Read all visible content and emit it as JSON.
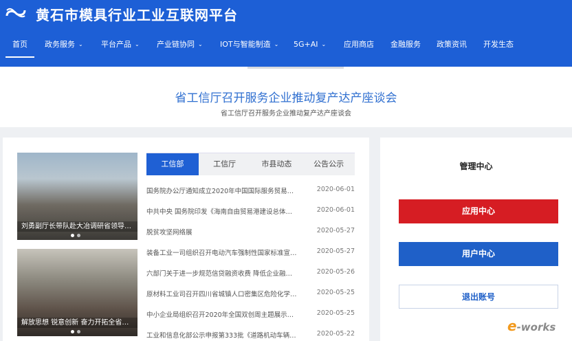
{
  "header": {
    "site_title": "黄石市模具行业工业互联网平台",
    "logo_icon": "infinity-logo-icon",
    "bg_color": "#1d5fd6"
  },
  "nav": {
    "items": [
      {
        "label": "首页",
        "chevron": false,
        "active": true
      },
      {
        "label": "政务服务",
        "chevron": true
      },
      {
        "label": "平台产品",
        "chevron": true
      },
      {
        "label": "产业链协同",
        "chevron": true
      },
      {
        "label": "IOT与智能制造",
        "chevron": true
      },
      {
        "label": "5G+AI",
        "chevron": true
      },
      {
        "label": "应用商店",
        "chevron": false
      },
      {
        "label": "金融服务",
        "chevron": false
      },
      {
        "label": "政策资讯",
        "chevron": false
      },
      {
        "label": "开发生态",
        "chevron": false
      }
    ],
    "chevron_glyph": "⌄"
  },
  "banner": {
    "title": "省工信厅召开服务企业推动复产达产座谈会",
    "subtitle": "省工信厅召开服务企业推动复产达产座谈会"
  },
  "photos": [
    {
      "caption": "刘勇副厅长带队赴大冶调研省领导…"
    },
    {
      "caption": "解放思想 锐意创新 奋力开拓全省工…"
    }
  ],
  "tabs": [
    {
      "label": "工信部",
      "active": true
    },
    {
      "label": "工信厅"
    },
    {
      "label": "市县动态"
    },
    {
      "label": "公告公示"
    }
  ],
  "news": [
    {
      "title": "国务院办公厅通知成立2020年中国国际服务贸易…",
      "date": "2020-06-01"
    },
    {
      "title": "中共中央 国务院印发《海南自由贸易港建设总体…",
      "date": "2020-06-01"
    },
    {
      "title": "脱贫攻坚网络展",
      "date": "2020-05-27"
    },
    {
      "title": "装备工业一司组织召开电动汽车强制性国家标准宣…",
      "date": "2020-05-27"
    },
    {
      "title": "六部门关于进一步规范信贷融资收费 降低企业融…",
      "date": "2020-05-26"
    },
    {
      "title": "原材料工业司召开四川省城镇人口密集区危险化学…",
      "date": "2020-05-25"
    },
    {
      "title": "中小企业局组织召开2020年全国双创周主题展示…",
      "date": "2020-05-25"
    },
    {
      "title": "工业和信息化部公示申报第333批《道路机动车辆…",
      "date": "2020-05-22"
    }
  ],
  "manage": {
    "title": "管理中心",
    "app_center": "应用中心",
    "user_center": "用户中心",
    "logout": "退出账号",
    "app_color": "#d61d23",
    "user_color": "#1f60c8"
  },
  "watermark": {
    "e": "e",
    "text": "-works"
  }
}
